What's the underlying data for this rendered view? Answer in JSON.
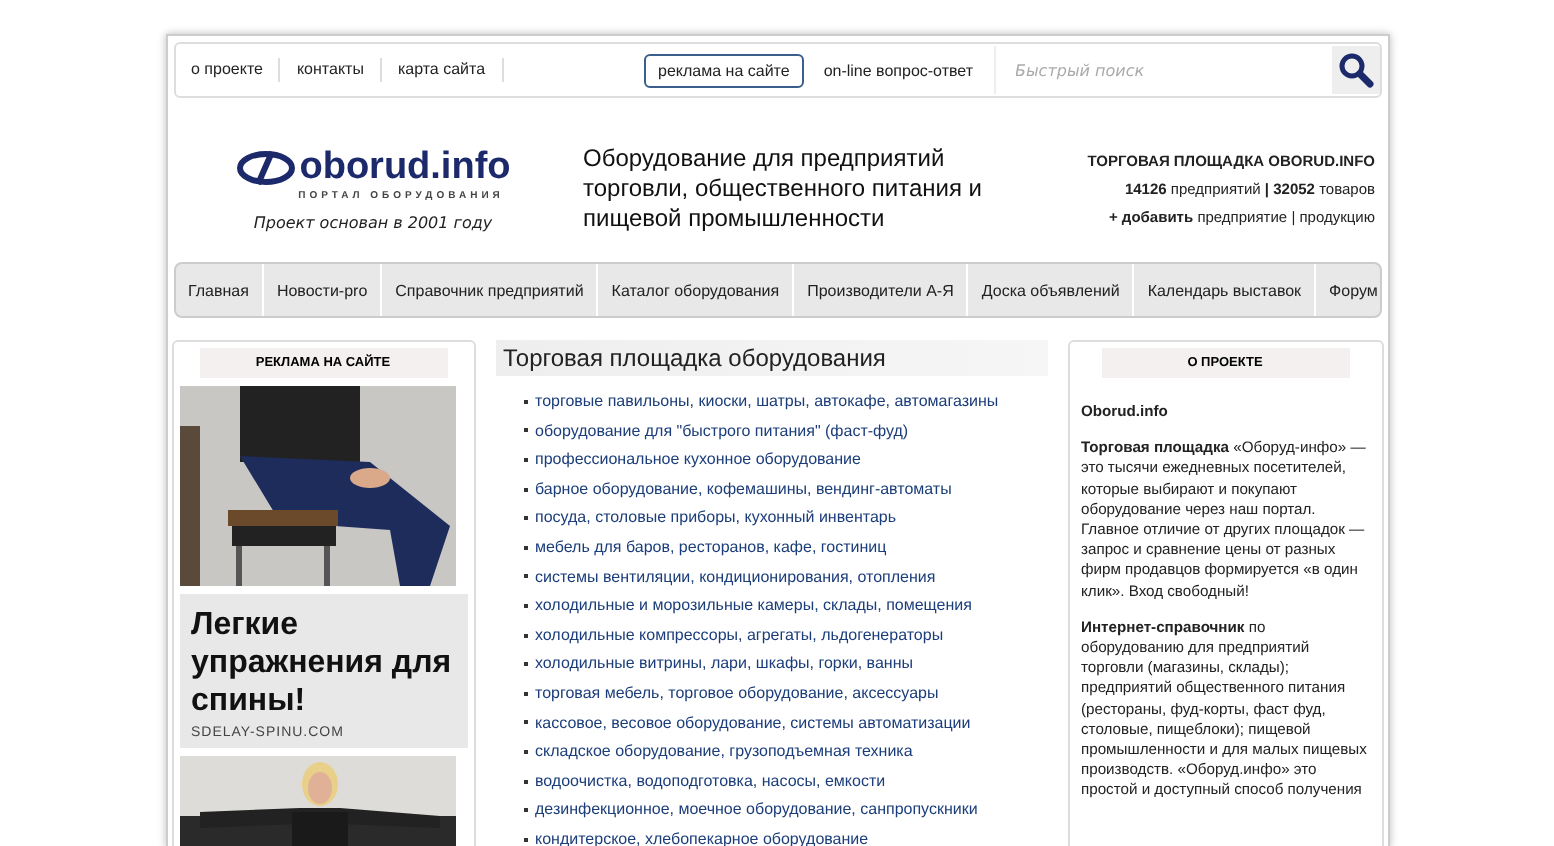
{
  "top_links": [
    "о проекте",
    "контакты",
    "карта сайта"
  ],
  "ad_button": "реклама на сайте",
  "qa_link": "on-line вопрос-ответ",
  "search": {
    "placeholder": "Быстрый поиск"
  },
  "logo": {
    "name": "oborud.info",
    "subtitle": "ПОРТАЛ ОБОРУДОВАНИЯ",
    "founded": "Проект основан в 2001 году"
  },
  "headline": "Оборудование для предприятий торговли, общественного питания и пищевой промышленности",
  "stats": {
    "title": "ТОРГОВАЯ ПЛОЩАДКА OBORUD.INFO",
    "companies": "14126",
    "companies_label": "предприятий",
    "goods": "32052",
    "goods_label": "товаров",
    "separator": "|",
    "add": "+ добавить",
    "add_company": "предприятие",
    "add_product": "продукцию"
  },
  "nav": [
    {
      "label": "Главная"
    },
    {
      "label": "Новости-pro"
    },
    {
      "label": "Справочник предприятий"
    },
    {
      "label": "Каталог оборудования"
    },
    {
      "label": "Производители А-Я"
    },
    {
      "label": "Доска объявлений"
    },
    {
      "label": "Календарь выставок"
    },
    {
      "label": "Форум"
    }
  ],
  "ad_panel": {
    "title": "РЕКЛАМА НА САЙТЕ",
    "ad_title": "Легкие упражнения для спины!",
    "ad_site": "SDELAY-SPINU.COM"
  },
  "catalog": {
    "title": "Торговая площадка оборудования",
    "items": [
      "торговые павильоны, киоски, шатры, автокафе, автомагазины",
      "оборудование для \"быстрого питания\" (фаст-фуд)",
      "профессиональное кухонное оборудование",
      "барное оборудование, кофемашины, вендинг-автоматы",
      "посуда, столовые приборы, кухонный инвентарь",
      "мебель для баров, ресторанов, кафе, гостиниц",
      "системы вентиляции, кондиционирования, отопления",
      "холодильные и морозильные камеры, склады, помещения",
      "холодильные компрессоры, агрегаты, льдогенераторы",
      "холодильные витрины, лари, шкафы, горки, ванны",
      "торговая мебель, торговое оборудование, аксессуары",
      "кассовое, весовое оборудование, системы автоматизации",
      "складское оборудование, грузоподъемная техника",
      "водоочистка, водоподготовка, насосы, емкости",
      "дезинфекционное, моечное оборудование, санпропускники",
      "кондитерское, хлебопекарное оборудование"
    ]
  },
  "about": {
    "title": "О ПРОЕКТЕ",
    "site": "Oborud.info",
    "paragraphs": [
      "**Торговая площадка** «Оборуд-инфо» — это тысячи ежедневных посетителей, которые выбирают и покупают оборудование через наш портал. Главное отличие от других площадок — запрос и сравнение цены от разных фирм продавцов формируется «в один клик». Вход свободный!",
      "**Интернет-справочник** по оборудованию для предприятий торговли (магазины, склады); предприятий общественного питания (рестораны, фуд-корты, фаст фуд, столовые, пищеблоки); пищевой промышленности и для малых пищевых производств. «Оборуд.инфо» это простой и доступный способ получения"
    ]
  }
}
